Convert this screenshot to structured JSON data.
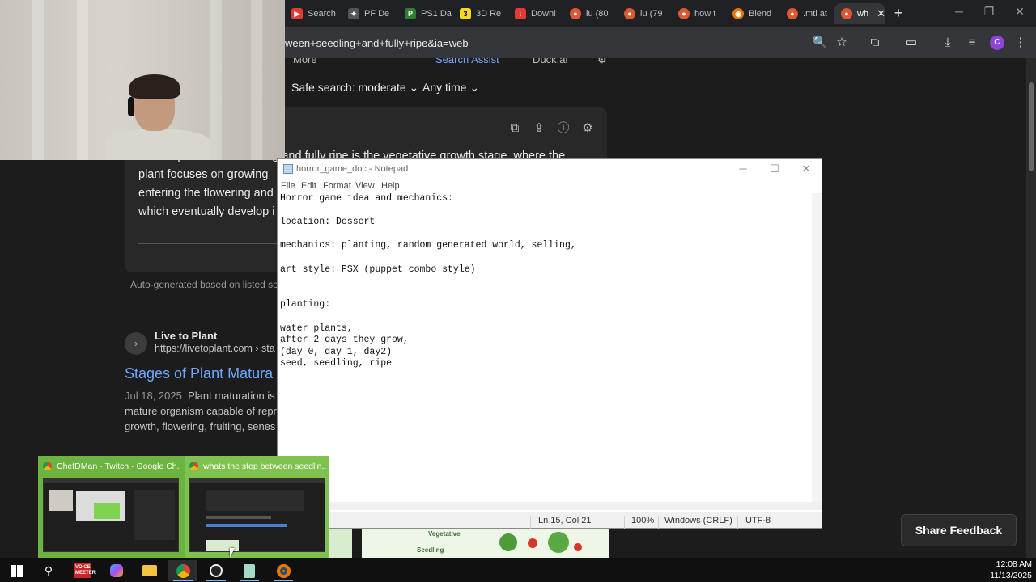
{
  "browser": {
    "tabs": [
      {
        "label": "Search",
        "icon": "youtube-studio-icon",
        "color": "#e53935"
      },
      {
        "label": "PF De",
        "icon": "puppet-icon",
        "color": "#555555"
      },
      {
        "label": "PS1 Da",
        "icon": "ps1-icon",
        "color": "#2e7d32"
      },
      {
        "label": "3D Re",
        "icon": "3d-icon",
        "color": "#f9d71c"
      },
      {
        "label": "Downl",
        "icon": "download-site-icon",
        "color": "#e53935"
      },
      {
        "label": "iu (80",
        "icon": "duckduckgo-icon",
        "color": "#de5833"
      },
      {
        "label": "iu (79",
        "icon": "duckduckgo-icon",
        "color": "#de5833"
      },
      {
        "label": "how t",
        "icon": "duckduckgo-icon",
        "color": "#de5833"
      },
      {
        "label": "Blend",
        "icon": "blender-icon",
        "color": "#ea7600"
      },
      {
        "label": ".mtl at",
        "icon": "duckduckgo-icon",
        "color": "#de5833"
      },
      {
        "label": "wh",
        "icon": "duckduckgo-icon",
        "color": "#de5833"
      }
    ],
    "new_tab": "+",
    "url": "ween+seedling+and+fully+ripe&ia=web",
    "profile_initial": "C"
  },
  "page": {
    "nav_more": "More",
    "search_assist": "Search Assist",
    "duck_ai": "Duck.ai",
    "safe_search": "Safe search: moderate",
    "any_time": "Any time",
    "assist_lines": [
      "The step between seedling and fully ripe is the vegetative growth stage, where the",
      "plant focuses on growing",
      "entering the flowering and",
      "which eventually develop i"
    ],
    "auto_generated": "Auto-generated based on listed sources",
    "source_name": "Live to Plant",
    "source_url": "https://livetoplant.com › sta",
    "result_title": "Stages of Plant Matura",
    "result_date": "Jul 18, 2025",
    "result_snippet_1": "Plant maturation is",
    "result_snippet_2": "mature organism capable of repr",
    "result_snippet_3": "growth, flowering, fruiting, senes",
    "share_feedback": "Share Feedback",
    "diagram_labels": {
      "vegetative": "Vegetative",
      "seedling": "Seedling"
    }
  },
  "notepad": {
    "title": "horror_game_doc - Notepad",
    "menu": [
      "File",
      "Edit",
      "Format",
      "View",
      "Help"
    ],
    "content": "Horror game idea and mechanics:\n\nlocation: Dessert\n\nmechanics: planting, random generated world, selling,\n\nart style: PSX (puppet combo style)\n\n\nplanting:\n\nwater plants,\nafter 2 days they grow,\n(day 0, day 1, day2)\nseed, seedling, ripe",
    "status": {
      "position": "Ln 15, Col 21",
      "zoom": "100%",
      "line_ending": "Windows (CRLF)",
      "encoding": "UTF-8"
    }
  },
  "thumbnails": [
    {
      "title": "ChefDMan - Twitch - Google Ch..."
    },
    {
      "title": "whats the step between seedlin..."
    }
  ],
  "taskbar": {
    "apps": [
      "start",
      "search",
      "voicemeeter",
      "copilot",
      "file-explorer",
      "chrome",
      "obs",
      "notepad",
      "blender"
    ],
    "voicemeeter_label": "VOICE MEETER",
    "time": "12:08 AM",
    "date": "11/13/2025"
  }
}
